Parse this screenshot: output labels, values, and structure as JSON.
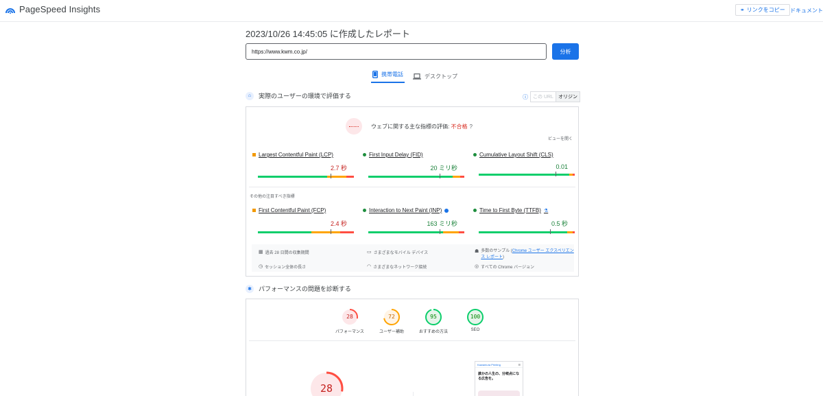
{
  "header": {
    "app_name": "PageSpeed Insights",
    "copy_link_label": "リンクをコピー",
    "docs_label": "ドキュメント"
  },
  "report": {
    "title": "2023/10/26 14:45:05 に作成したレポート",
    "url_value": "https://www.kwm.co.jp/",
    "analyze_label": "分析"
  },
  "tabs": {
    "mobile": "携帯電話",
    "desktop": "デスクトップ",
    "selected": "mobile"
  },
  "field": {
    "heading": "実際のユーザーの環境で評価する",
    "toggle_url": "この URL",
    "toggle_origin": "オリジン",
    "toggle_selected": "origin",
    "assessment_prefix": "ウェブに関する主な指標の評価: ",
    "assessment_result": "不合格",
    "expand_label": "ビューを開く",
    "other_label": "その他の注目すべき指標",
    "metrics_core": [
      {
        "name": "Largest Contentful Paint (LCP)",
        "value": "2.7 秒",
        "status": "average",
        "dist": [
          0.72,
          0.2,
          0.08
        ],
        "marker": 0.76
      },
      {
        "name": "First Input Delay (FID)",
        "value": "20 ミリ秒",
        "status": "good",
        "dist": [
          0.88,
          0.08,
          0.04
        ],
        "marker": 0.74
      },
      {
        "name": "Cumulative Layout Shift (CLS)",
        "value": "0.01",
        "status": "good",
        "dist": [
          0.94,
          0.04,
          0.02
        ],
        "marker": 0.8
      }
    ],
    "metrics_other": [
      {
        "name": "First Contentful Paint (FCP)",
        "value": "2.4 秒",
        "status": "average",
        "dist": [
          0.56,
          0.3,
          0.14
        ],
        "marker": 0.76
      },
      {
        "name": "Interaction to Next Paint (INP)",
        "value": "163 ミリ秒",
        "status": "good",
        "dist": [
          0.78,
          0.16,
          0.06
        ],
        "marker": 0.74
      },
      {
        "name": "Time to First Byte (TTFB)",
        "value": "0.5 秒",
        "status": "good",
        "dist": [
          0.92,
          0.06,
          0.02
        ],
        "marker": 0.74
      }
    ],
    "footer": {
      "period": "過去 28 日間の収集期間",
      "devices": "さまざまなモバイル デバイス",
      "samples_prefix": "多数のサンプル (",
      "samples_link": "Chrome ユーザー エクスペリエンス レポート",
      "samples_suffix": ")",
      "duration": "セッション全体の長さ",
      "network": "さまざまなネットワーク接続",
      "chrome": "すべての Chrome バージョン"
    }
  },
  "lab": {
    "heading": "パフォーマンスの問題を診断する",
    "scores": [
      {
        "label": "パフォーマンス",
        "score": "28",
        "color": "#ff4e42",
        "fill": 0.28
      },
      {
        "label": "ユーザー補助",
        "score": "72",
        "color": "#ffa400",
        "fill": 0.72
      },
      {
        "label": "おすすめの方法",
        "score": "95",
        "color": "#0cce6b",
        "fill": 0.95
      },
      {
        "label": "SEO",
        "score": "100",
        "color": "#0cce6b",
        "fill": 1.0
      }
    ],
    "big_score": "28",
    "big_fill": 0.28,
    "screenshot": {
      "brand": "Kawamura Printing",
      "headline": "誰かの人生の、分岐点になる広告を。"
    }
  }
}
